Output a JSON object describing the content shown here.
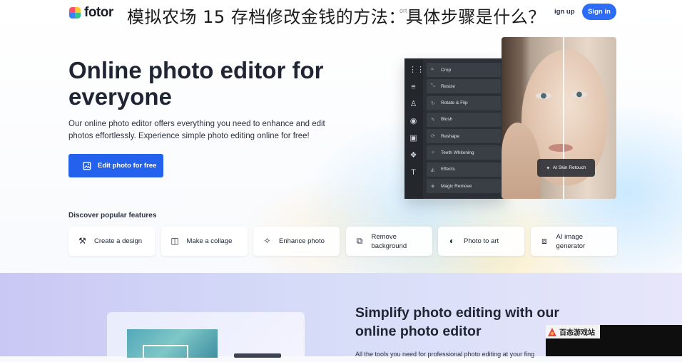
{
  "header": {
    "logo_text": "fotor",
    "overlay_title": "模拟农场 15 存档修改金钱的方法：具体步骤是什么？",
    "nav_ghost": "ort ⌄",
    "signup_label": "ign up",
    "signin_label": "Sign in"
  },
  "hero": {
    "title": "Online photo editor for everyone",
    "description": "Our online photo editor offers everything you need to enhance and edit photos effortlessly. Experience simple photo editing online for free!",
    "cta_label": "Edit photo for free"
  },
  "editor": {
    "menu": [
      "Crop",
      "Resize",
      "Rotate & Flip",
      "Blush",
      "Reshape",
      "Teeth Whitening",
      "Effects",
      "Magic Remove"
    ],
    "retouch_label": "AI Skin Retouch"
  },
  "features": {
    "heading": "Discover popular features",
    "items": [
      {
        "label": "Create a design",
        "icon": "magic-wand-icon"
      },
      {
        "label": "Make a collage",
        "icon": "collage-icon"
      },
      {
        "label": "Enhance photo",
        "icon": "enhance-icon"
      },
      {
        "label": "Remove background",
        "icon": "remove-bg-icon"
      },
      {
        "label": "Photo to art",
        "icon": "art-icon"
      },
      {
        "label": "AI image generator",
        "icon": "ai-generator-icon"
      }
    ]
  },
  "lower": {
    "title": "Simplify photo editing with our online photo editor",
    "description": "All the tools you need for professional photo editing at your fing"
  },
  "watermark": {
    "text": "百态游戏站"
  },
  "colors": {
    "accent": "#2c6cf6",
    "cta": "#2462ee",
    "editor_panel": "#2c3036"
  }
}
